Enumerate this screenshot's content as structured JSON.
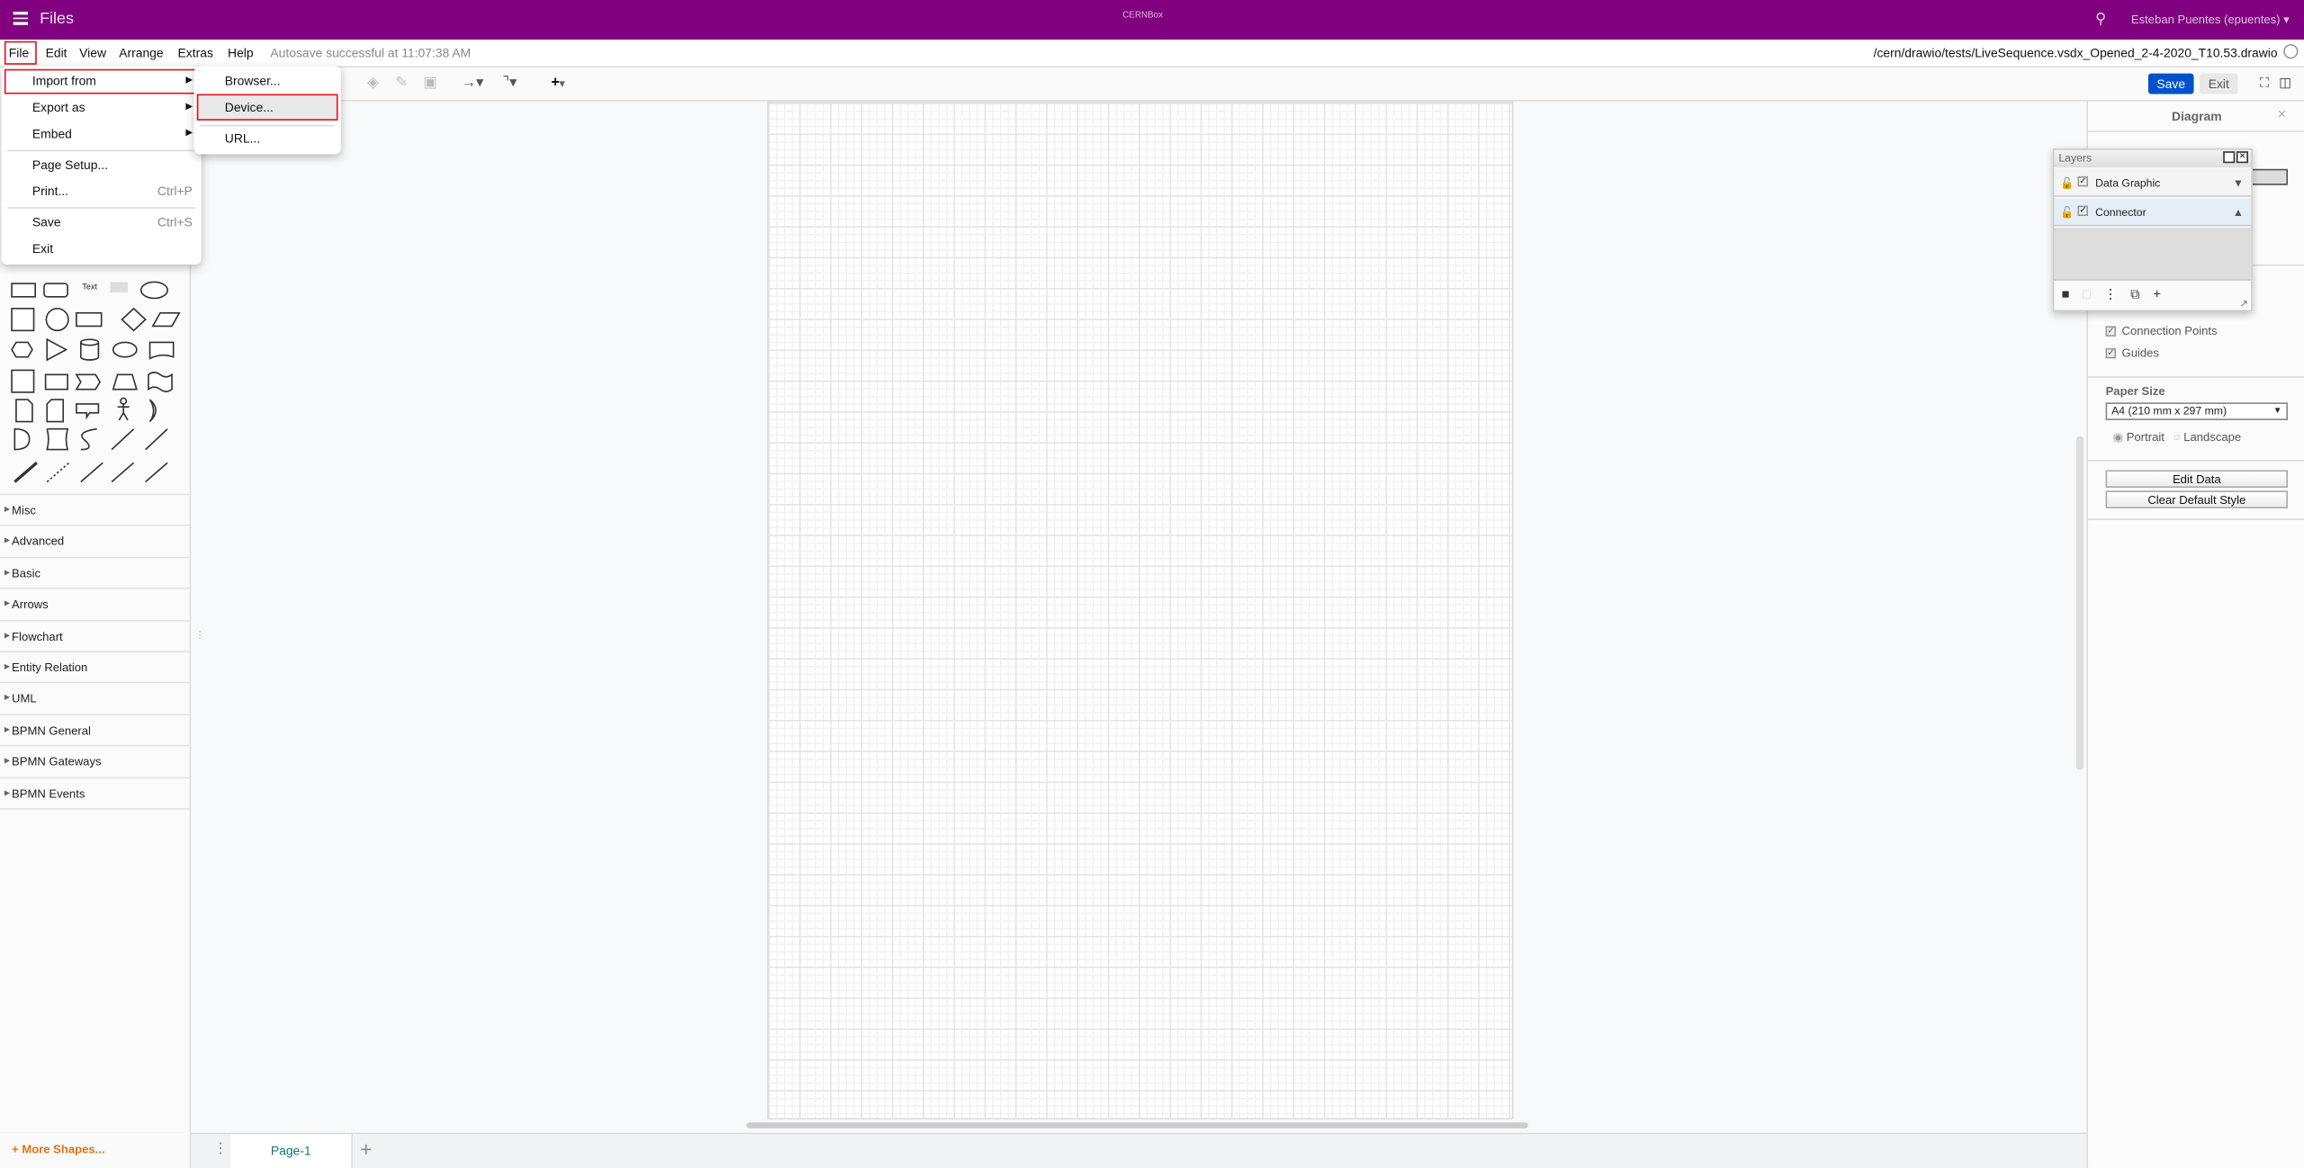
{
  "topbar": {
    "title": "Files",
    "logo": "CERNBox",
    "user": "Esteban Puentes (epuentes) ▾",
    "bg": "#810080"
  },
  "menubar": {
    "items": [
      "File",
      "Edit",
      "View",
      "Arrange",
      "Extras",
      "Help"
    ],
    "autosave": "Autosave successful at 11:07:38 AM",
    "filename": "/cern/drawio/tests/LiveSequence.vsdx_Opened_2-4-2020_T10.53.drawio"
  },
  "toolbar": {
    "save": "Save",
    "exit": "Exit",
    "save_color": "#0052cc"
  },
  "file_menu": {
    "items": [
      {
        "label": "Import from",
        "submenu": true
      },
      {
        "label": "Export as",
        "submenu": true
      },
      {
        "label": "Embed",
        "submenu": true
      },
      {
        "label": "Page Setup..."
      },
      {
        "label": "Print...",
        "shortcut": "Ctrl+P"
      },
      {
        "label": "Save",
        "shortcut": "Ctrl+S"
      },
      {
        "label": "Exit"
      }
    ]
  },
  "import_submenu": {
    "items": [
      "Browser...",
      "Device...",
      "URL..."
    ]
  },
  "sidebar": {
    "shape_text": "Text",
    "categories": [
      "Misc",
      "Advanced",
      "Basic",
      "Arrows",
      "Flowchart",
      "Entity Relation",
      "UML",
      "BPMN General",
      "BPMN Gateways",
      "BPMN Events"
    ],
    "more_shapes": "+ More Shapes..."
  },
  "pages": {
    "tabs": [
      "Page-1"
    ]
  },
  "right_panel": {
    "title": "Diagram",
    "connection_points": "Connection Points",
    "guides": "Guides",
    "paper_size_label": "Paper Size",
    "paper_size": "A4 (210 mm x 297 mm)",
    "portrait": "Portrait",
    "landscape": "Landscape",
    "orientation": "portrait",
    "edit_data": "Edit Data",
    "clear_default_style": "Clear Default Style"
  },
  "layers": {
    "title": "Layers",
    "items": [
      {
        "name": "Data Graphic",
        "visible": true
      },
      {
        "name": "Connector",
        "visible": true,
        "selected": true
      }
    ]
  }
}
